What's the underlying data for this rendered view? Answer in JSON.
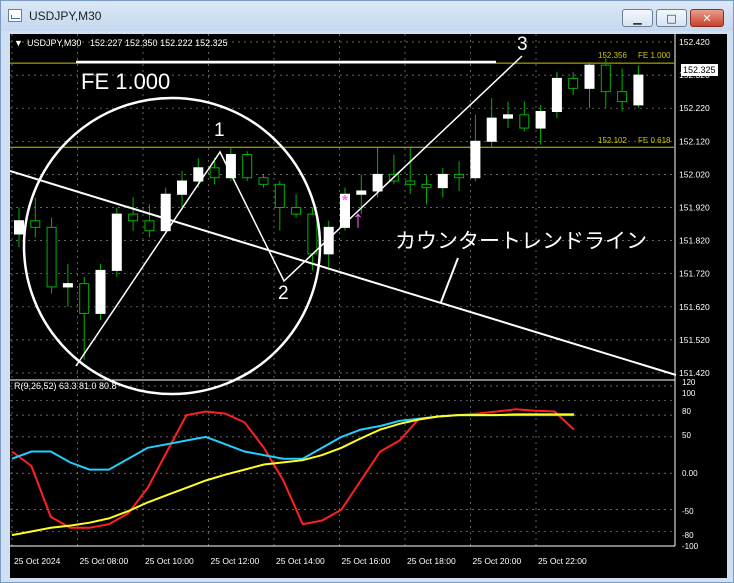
{
  "window": {
    "title": "USDJPY,M30",
    "buttons": {
      "minimize": "▁",
      "maximize": "□",
      "close": "✕"
    }
  },
  "chart": {
    "symbol_header": "USDJPY,M30",
    "ohlc_header": "152.227 152.350 152.222 152.325",
    "header_arrow": "▼",
    "current_price": "152.325",
    "fe_label_large": "FE 1.000",
    "fe_line_1": {
      "price": "152.356",
      "label": "FE 1.000"
    },
    "fe_line_2": {
      "price": "152.102",
      "label": "FE 0.618"
    },
    "wave_labels": [
      "1",
      "2",
      "3"
    ],
    "annotation": "カウンタートレンドライン",
    "up_arrow": "↑",
    "star": "*",
    "colors": {
      "background": "#000000",
      "bull": "#00b400",
      "bear": "#ffffff",
      "grid": "#888888",
      "fe": "#c8c800",
      "rsi_red": "#ff2020",
      "rsi_cyan": "#20d0ff",
      "rsi_yellow": "#ffff20"
    }
  },
  "indicator": {
    "label": "R(9,26,52) 63.3 81.0 80.8",
    "levels": [
      "120",
      "100",
      "80",
      "50",
      "0.00",
      "-50",
      "-80",
      "-100"
    ]
  },
  "chart_data": {
    "type": "candlestick",
    "price_axis_ticks": [
      152.42,
      152.32,
      152.22,
      152.12,
      152.02,
      151.92,
      151.82,
      151.72,
      151.62,
      151.52,
      151.42
    ],
    "time_axis_ticks": [
      "25 Oct 2024",
      "25 Oct 08:00",
      "25 Oct 10:00",
      "25 Oct 12:00",
      "25 Oct 14:00",
      "25 Oct 16:00",
      "25 Oct 18:00",
      "25 Oct 20:00",
      "25 Oct 22:00"
    ],
    "candles": [
      [
        151.84,
        151.92,
        151.8,
        151.88
      ],
      [
        151.88,
        151.95,
        151.83,
        151.86
      ],
      [
        151.86,
        151.89,
        151.66,
        151.68
      ],
      [
        151.68,
        151.75,
        151.62,
        151.69
      ],
      [
        151.69,
        151.71,
        151.46,
        151.6
      ],
      [
        151.6,
        151.75,
        151.58,
        151.73
      ],
      [
        151.73,
        151.92,
        151.71,
        151.9
      ],
      [
        151.9,
        151.95,
        151.85,
        151.88
      ],
      [
        151.88,
        151.93,
        151.83,
        151.85
      ],
      [
        151.85,
        151.98,
        151.84,
        151.96
      ],
      [
        151.96,
        152.03,
        151.92,
        152.0
      ],
      [
        152.0,
        152.07,
        151.98,
        152.04
      ],
      [
        152.04,
        152.07,
        151.99,
        152.01
      ],
      [
        152.01,
        152.1,
        152.0,
        152.08
      ],
      [
        152.08,
        152.09,
        152.0,
        152.01
      ],
      [
        152.01,
        152.02,
        151.98,
        151.99
      ],
      [
        151.99,
        152.0,
        151.85,
        151.92
      ],
      [
        151.92,
        151.96,
        151.89,
        151.9
      ],
      [
        151.9,
        151.92,
        151.73,
        151.78
      ],
      [
        151.78,
        151.88,
        151.74,
        151.86
      ],
      [
        151.86,
        151.98,
        151.85,
        151.96
      ],
      [
        151.96,
        152.02,
        151.9,
        151.97
      ],
      [
        151.97,
        152.1,
        151.95,
        152.02
      ],
      [
        152.02,
        152.08,
        151.99,
        152.0
      ],
      [
        152.0,
        152.1,
        151.96,
        151.99
      ],
      [
        151.99,
        152.02,
        151.93,
        151.98
      ],
      [
        151.98,
        152.04,
        151.95,
        152.02
      ],
      [
        152.02,
        152.06,
        151.97,
        152.01
      ],
      [
        152.01,
        152.2,
        152.0,
        152.12
      ],
      [
        152.12,
        152.25,
        152.1,
        152.19
      ],
      [
        152.19,
        152.24,
        152.16,
        152.2
      ],
      [
        152.2,
        152.24,
        152.15,
        152.16
      ],
      [
        152.16,
        152.23,
        152.11,
        152.21
      ],
      [
        152.21,
        152.33,
        152.19,
        152.31
      ],
      [
        152.31,
        152.33,
        152.26,
        152.28
      ],
      [
        152.28,
        152.36,
        152.22,
        152.35
      ],
      [
        152.35,
        152.37,
        152.22,
        152.27
      ],
      [
        152.27,
        152.34,
        152.21,
        152.24
      ],
      [
        152.23,
        152.35,
        152.22,
        152.32
      ]
    ],
    "fe_levels": [
      {
        "label": "FE 1.000",
        "value": 152.356
      },
      {
        "label": "FE 0.618",
        "value": 152.102
      }
    ],
    "waves": [
      {
        "label": "1",
        "value": 152.09
      },
      {
        "label": "2",
        "value": 151.71
      },
      {
        "label": "3",
        "value": 152.36
      }
    ],
    "indicator_axis": [
      120,
      100,
      80,
      50,
      0,
      -50,
      -80,
      -100
    ],
    "rsi_series": [
      {
        "name": "R9",
        "values": [
          30,
          10,
          -60,
          -75,
          -75,
          -70,
          -55,
          -20,
          30,
          80,
          85,
          82,
          70,
          35,
          -10,
          -70,
          -65,
          -50,
          -10,
          30,
          45,
          75,
          78,
          80,
          82,
          85,
          88,
          86,
          85,
          60
        ]
      },
      {
        "name": "R26",
        "values": [
          20,
          30,
          30,
          15,
          5,
          5,
          20,
          35,
          40,
          45,
          50,
          40,
          30,
          25,
          20,
          20,
          35,
          50,
          60,
          65,
          72,
          75,
          78,
          80,
          80,
          80,
          80,
          80,
          80,
          80
        ]
      },
      {
        "name": "R52",
        "values": [
          -85,
          -80,
          -75,
          -72,
          -68,
          -62,
          -52,
          -40,
          -30,
          -20,
          -10,
          -2,
          5,
          12,
          15,
          18,
          25,
          35,
          48,
          60,
          68,
          74,
          78,
          80,
          80,
          80,
          81,
          81,
          81,
          81
        ]
      }
    ]
  }
}
